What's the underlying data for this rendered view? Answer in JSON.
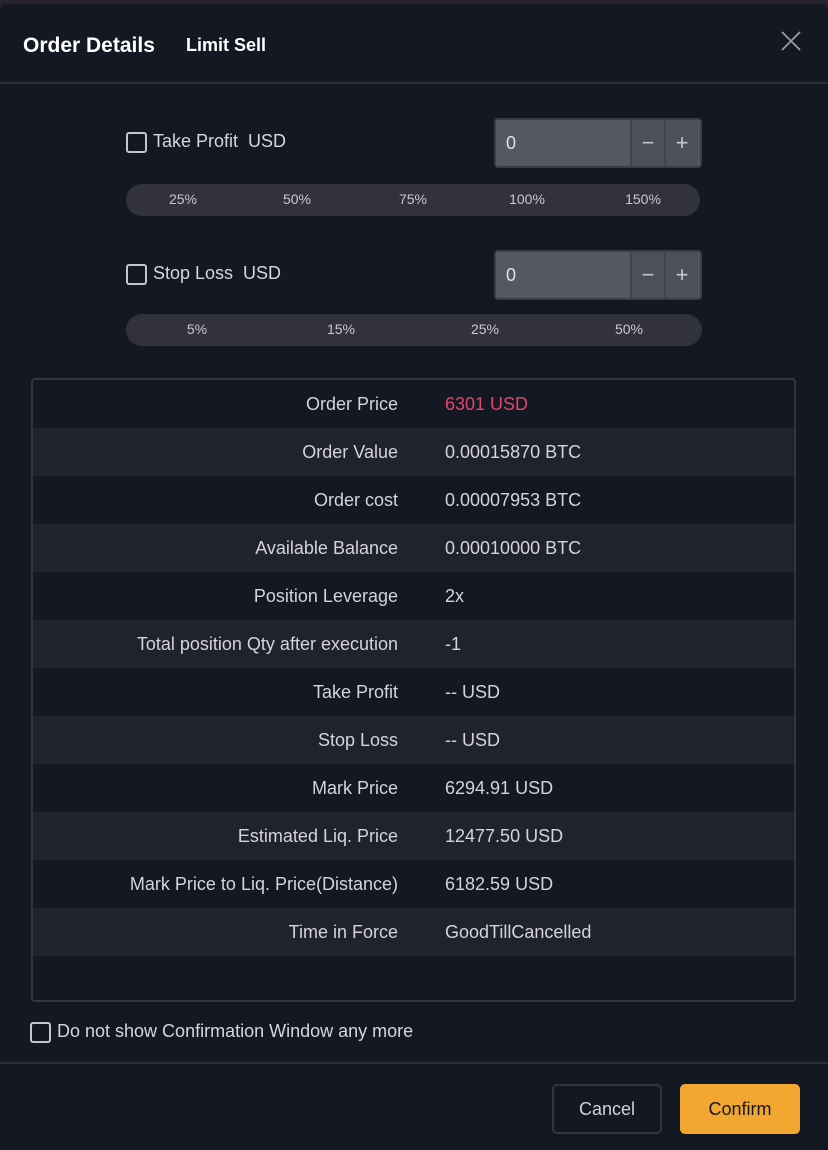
{
  "header": {
    "title": "Order Details",
    "subtitle": "Limit Sell",
    "close_icon": "close-icon"
  },
  "take_profit": {
    "checked": false,
    "label": "Take Profit  USD",
    "value": "0",
    "decrement_label": "−",
    "increment_label": "+",
    "presets": [
      "25%",
      "50%",
      "75%",
      "100%",
      "150%"
    ]
  },
  "stop_loss": {
    "checked": false,
    "label": "Stop Loss  USD",
    "value": "0",
    "decrement_label": "−",
    "increment_label": "+",
    "presets": [
      "5%",
      "15%",
      "25%",
      "50%"
    ]
  },
  "details": [
    {
      "label": "Order Price",
      "value": "6301 USD",
      "highlight": true
    },
    {
      "label": "Order Value",
      "value": "0.00015870 BTC"
    },
    {
      "label": "Order cost",
      "value": "0.00007953 BTC"
    },
    {
      "label": "Available Balance",
      "value": "0.00010000 BTC"
    },
    {
      "label": "Position Leverage",
      "value": "2x"
    },
    {
      "label": "Total position Qty after execution",
      "value": "-1"
    },
    {
      "label": "Take Profit",
      "value": "-- USD"
    },
    {
      "label": "Stop Loss",
      "value": "-- USD"
    },
    {
      "label": "Mark Price",
      "value": "6294.91 USD"
    },
    {
      "label": "Estimated Liq. Price",
      "value": "12477.50 USD"
    },
    {
      "label": "Mark Price to Liq. Price(Distance)",
      "value": "6182.59 USD"
    },
    {
      "label": "Time in Force",
      "value": "GoodTillCancelled"
    }
  ],
  "dont_show": {
    "checked": false,
    "label": "Do not show Confirmation Window any more"
  },
  "footer": {
    "cancel_label": "Cancel",
    "confirm_label": "Confirm"
  },
  "colors": {
    "accent": "#f2a830",
    "sell_price": "#e0466e",
    "background": "#141822"
  }
}
